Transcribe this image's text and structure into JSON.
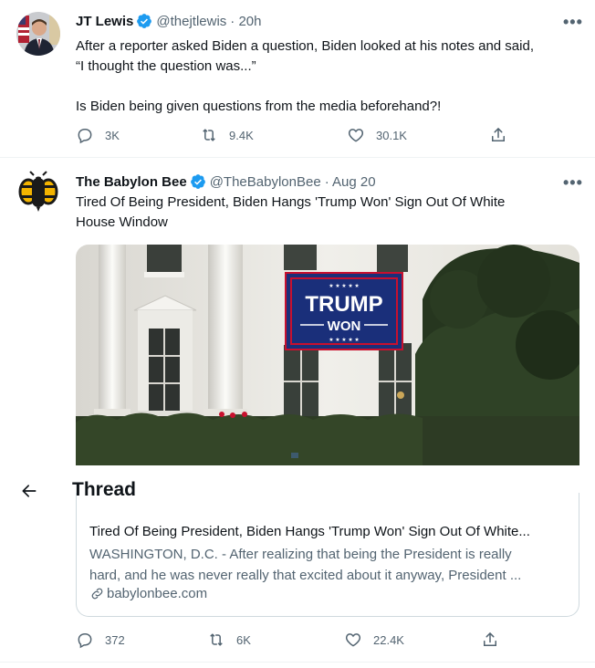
{
  "tweets": [
    {
      "name": "JT Lewis",
      "handle": "@thejtlewis",
      "time": "· 20h",
      "text_line1": "After a reporter asked Biden a question, Biden looked at his notes and said,",
      "text_line2": "“I thought the question was...”",
      "text_line3": "Is Biden being given questions from the media beforehand?!",
      "replies": "3K",
      "retweets": "9.4K",
      "likes": "30.1K"
    },
    {
      "name": "The Babylon Bee",
      "handle": "@TheBabylonBee",
      "time": "· Aug 20",
      "text_line1": "Tired Of Being President, Biden Hangs 'Trump Won' Sign Out Of White",
      "text_line2": "House Window",
      "image": {
        "flag_top": "TRUMP",
        "flag_bottom": "WON"
      },
      "card": {
        "title": "Tired Of Being President, Biden Hangs 'Trump Won' Sign Out Of White...",
        "desc_line1": "WASHINGTON, D.C. - After realizing that being the President is really",
        "desc_line2": "hard, and he was never really that excited about it anyway, President ...",
        "domain": "babylonbee.com"
      },
      "replies": "372",
      "retweets": "6K",
      "likes": "22.4K"
    }
  ],
  "thread_header": {
    "title": "Thread"
  },
  "more_glyph": "•••",
  "colors": {
    "text": "#0f1419",
    "secondary": "#536471",
    "verified": "#1d9bf0",
    "border": "#cfd9de"
  }
}
